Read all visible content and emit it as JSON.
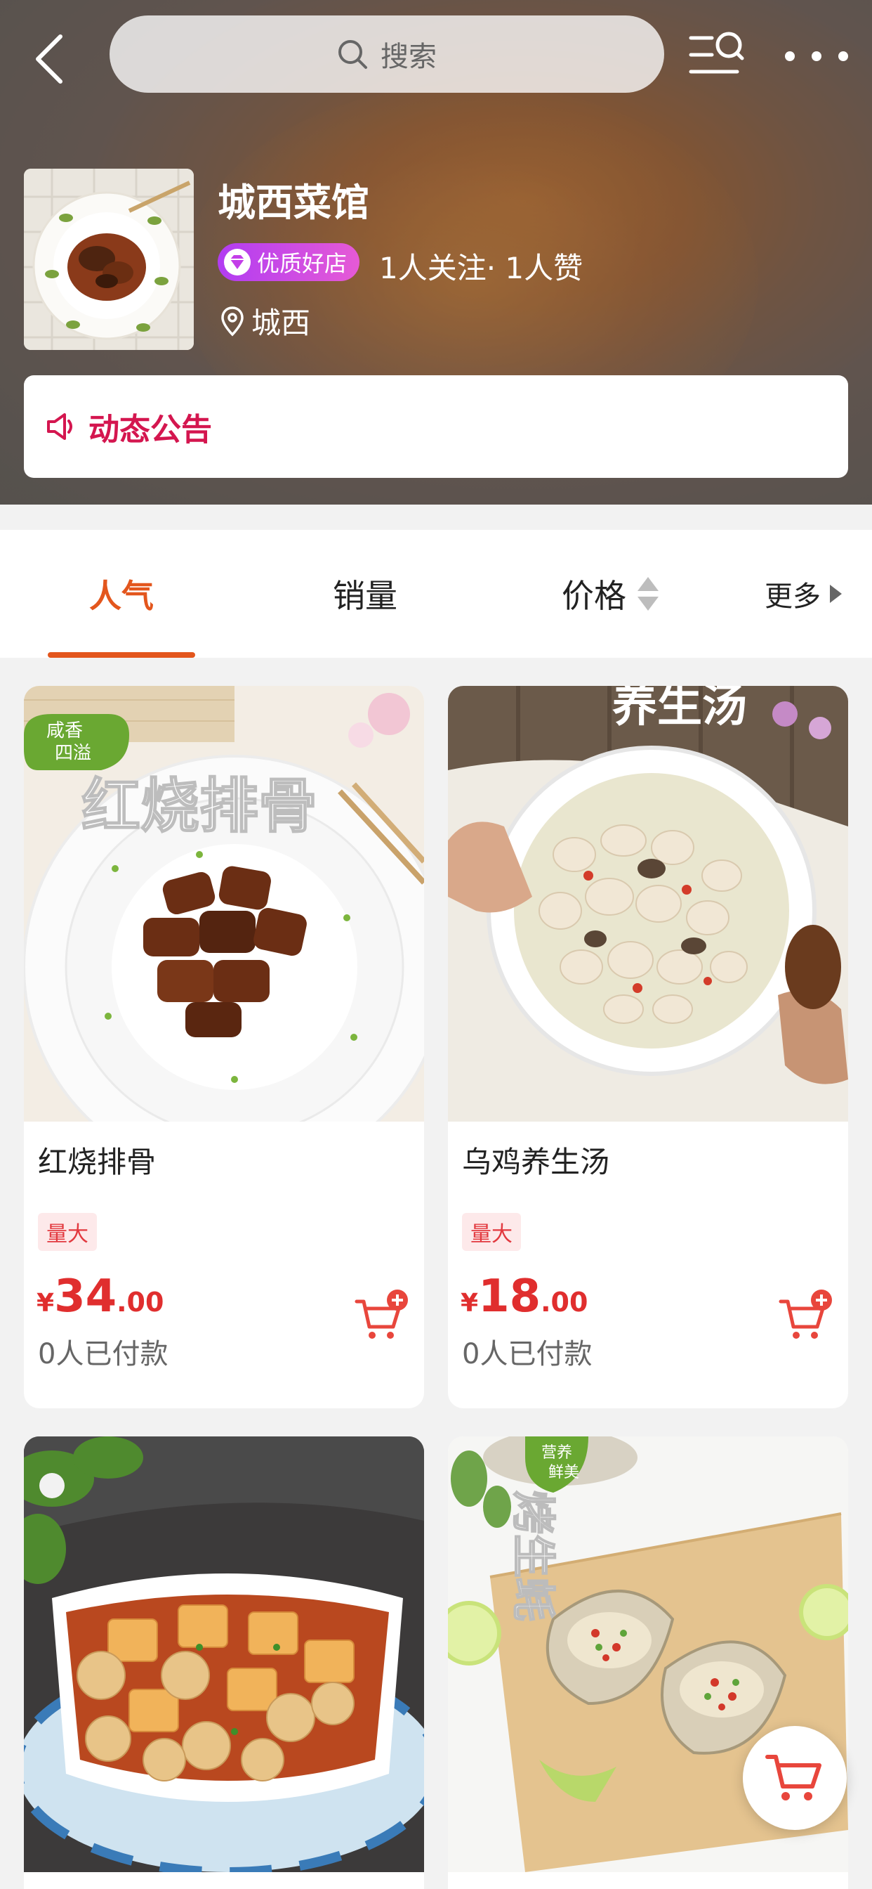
{
  "header": {
    "search_placeholder": "搜索"
  },
  "shop": {
    "name": "城西菜馆",
    "badge": "优质好店",
    "stats": "1人关注· 1人赞",
    "location": "城西"
  },
  "notice": {
    "label": "动态公告"
  },
  "tabs": [
    {
      "label": "人气",
      "active": true
    },
    {
      "label": "销量",
      "active": false
    },
    {
      "label": "价格",
      "active": false
    },
    {
      "label": "更多",
      "active": false
    }
  ],
  "products": [
    {
      "title": "红烧排骨",
      "tag": "量大",
      "currency": "¥",
      "price_int": "34",
      "price_dec": ".00",
      "paid": "0人已付款",
      "image_text": "红烧排骨",
      "image_badge": [
        "咸香",
        "四溢"
      ]
    },
    {
      "title": "乌鸡养生汤",
      "tag": "量大",
      "currency": "¥",
      "price_int": "18",
      "price_dec": ".00",
      "paid": "0人已付款",
      "image_text": "养生汤"
    },
    {
      "title": "",
      "image_text": ""
    },
    {
      "title": "",
      "image_text": "烤生蚝",
      "image_badge": [
        "营养",
        "鲜美"
      ]
    }
  ],
  "colors": {
    "accent": "#e3561d",
    "price": "#e02e2e",
    "notice": "#d4164f",
    "badge_gradient_start": "#b13cf2",
    "badge_gradient_end": "#e65ad6"
  }
}
